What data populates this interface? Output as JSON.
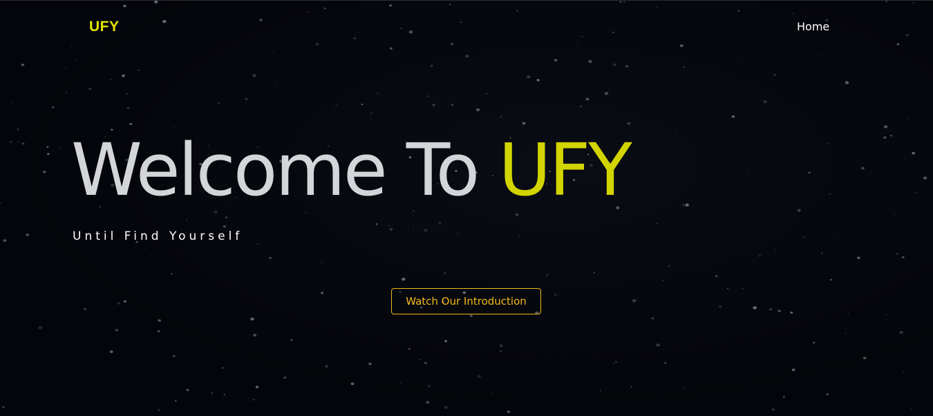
{
  "header": {
    "logo_text": "UFY",
    "nav_items": [
      {
        "label": "Home"
      }
    ]
  },
  "hero": {
    "title_main": "Welcome To ",
    "title_brand": "UFY",
    "tagline": "Until Find Yourself",
    "cta_label": "Watch Our Introduction"
  },
  "colors": {
    "background": "#04050a",
    "brand_yellow": "#e5e500",
    "title_grey": "#d4d5d8",
    "cta_orange": "#f5b91a"
  }
}
